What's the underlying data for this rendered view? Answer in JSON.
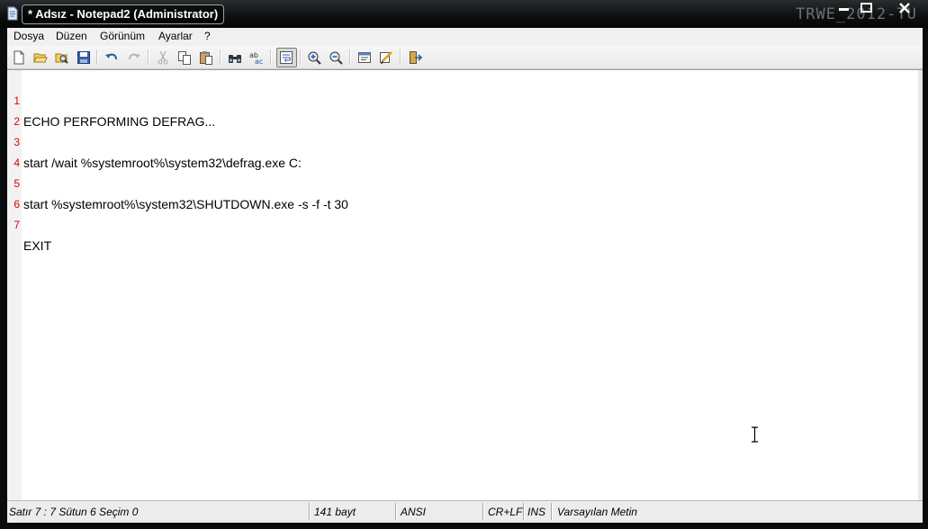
{
  "window": {
    "title": "* Adsız - Notepad2 (Administrator)",
    "background_watermark": "TRWE_2012-TU"
  },
  "menu": {
    "items": [
      "Dosya",
      "Düzen",
      "Görünüm",
      "Ayarlar",
      "?"
    ]
  },
  "toolbar": {
    "buttons": [
      "new-file-icon",
      "open-file-icon",
      "browse-icon",
      "save-icon",
      "undo-icon",
      "redo-icon",
      "cut-icon",
      "copy-icon",
      "paste-icon",
      "find-icon",
      "replace-icon",
      "word-wrap-icon",
      "zoom-in-icon",
      "zoom-out-icon",
      "scheme-icon",
      "customize-scheme-icon",
      "exit-icon"
    ]
  },
  "editor": {
    "lines": [
      {
        "number": "1",
        "text": "ECHO PERFORMING DEFRAG..."
      },
      {
        "number": "2",
        "text": ""
      },
      {
        "number": "3",
        "text": "start /wait %systemroot%\\system32\\defrag.exe C:"
      },
      {
        "number": "4",
        "text": ""
      },
      {
        "number": "5",
        "text": "start %systemroot%\\system32\\SHUTDOWN.exe -s -f -t 30"
      },
      {
        "number": "6",
        "text": ""
      },
      {
        "number": "7",
        "text": "EXIT"
      }
    ]
  },
  "status": {
    "position": "Satır 7 : 7   Sütun 6   Seçim 0",
    "size": "141 bayt",
    "encoding": "ANSI",
    "line_ending": "CR+LF",
    "insert_mode": "INS",
    "scheme": "Varsayılan Metin"
  },
  "colors": {
    "line_number": "#e00000",
    "title_text": "#ffffff",
    "frame": "#0a0c0c"
  }
}
